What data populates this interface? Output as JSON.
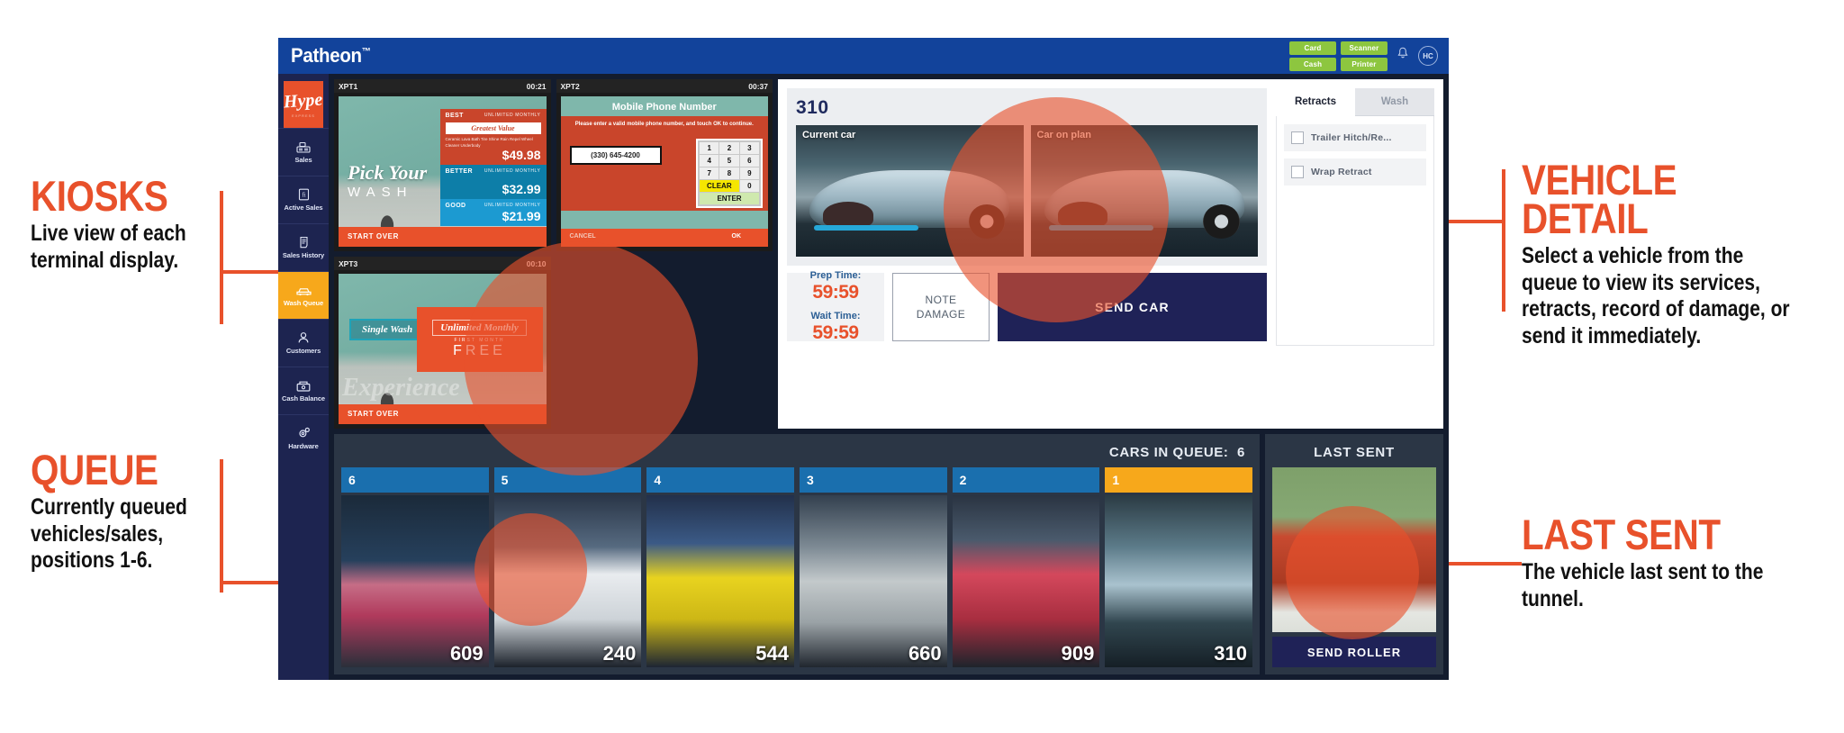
{
  "annotations": [
    {
      "id": "kiosks",
      "title": "KIOSKS",
      "body": "Live view of each terminal display."
    },
    {
      "id": "queue",
      "title": "QUEUE",
      "body": "Currently queued vehicles/sales, positions 1-6."
    },
    {
      "id": "vehicle",
      "title": "VEHICLE DETAIL",
      "body": "Select a vehicle from the queue to view its services, retracts, record of damage, or send it immediately."
    },
    {
      "id": "lastsent",
      "title": "LAST SENT",
      "body": "The vehicle last sent to the tunnel."
    }
  ],
  "app": {
    "brand": "Patheon",
    "brand_mark": "™",
    "header": {
      "badges": [
        "Card",
        "Scanner",
        "Cash",
        "Printer"
      ],
      "bell_icon": "bell-icon",
      "avatar_initials": "HC",
      "badge_color": "#8dc63f",
      "titlebar_color": "#12439b"
    },
    "sidebar": {
      "logo_word": "Hype",
      "logo_sub": "EXPRESS",
      "items": [
        {
          "label": "Sales",
          "icon": "register-icon",
          "active": false
        },
        {
          "label": "Active Sales",
          "icon": "receipt-icon",
          "active": false
        },
        {
          "label": "Sales History",
          "icon": "printout-icon",
          "active": false
        },
        {
          "label": "Wash Queue",
          "icon": "car-icon",
          "active": true
        },
        {
          "label": "Customers",
          "icon": "person-icon",
          "active": false
        },
        {
          "label": "Cash Balance",
          "icon": "cashbox-icon",
          "active": false
        },
        {
          "label": "Hardware",
          "icon": "gear-icon",
          "active": false
        }
      ],
      "active_color": "#F7A81B"
    },
    "kiosks": [
      {
        "name": "XPT1",
        "timer": "00:21",
        "type": "pick-wash",
        "headline_script": "Pick Your",
        "headline_spaced": "WASH",
        "start_over": "START OVER",
        "tiers": [
          {
            "name": "BEST",
            "monthly": "UNLIMITED MONTHLY",
            "pill": "Greatest Value",
            "price": "$49.98",
            "features": "Ceramic\nLava Bath\nTire Shine\nRain Repel\nWheel Cleaner\nUnderbody"
          },
          {
            "name": "BETTER",
            "monthly": "UNLIMITED MONTHLY",
            "pill": "",
            "price": "$32.99",
            "features": ""
          },
          {
            "name": "GOOD",
            "monthly": "UNLIMITED MONTHLY",
            "pill": "",
            "price": "$21.99",
            "features": ""
          }
        ]
      },
      {
        "name": "XPT2",
        "timer": "00:37",
        "type": "phone-entry",
        "title": "Mobile Phone Number",
        "instruction": "Please enter a valid mobile phone number, and touch OK to continue.",
        "value": "(330) 645-4200",
        "keys": [
          "1",
          "2",
          "3",
          "4",
          "5",
          "6",
          "7",
          "8",
          "9"
        ],
        "clear_label": "CLEAR",
        "zero_label": "0",
        "enter_label": "ENTER",
        "cancel_label": "CANCEL",
        "ok_label": "OK"
      },
      {
        "name": "XPT3",
        "timer": "00:10",
        "type": "choose-plan",
        "single_label": "Single Wash",
        "unlimited_label": "Unlimited Monthly",
        "unlimited_sub": "FIRST MONTH",
        "unlimited_free": "FREE",
        "ghost_word": "Experience",
        "start_over": "START OVER"
      }
    ],
    "vehicle_detail": {
      "number": "310",
      "current_car_label": "Current car",
      "car_on_plan_label": "Car on plan",
      "prep_time_label": "Prep Time:",
      "prep_time_value": "59:59",
      "wait_time_label": "Wait Time:",
      "wait_time_value": "59:59",
      "note_damage_line1": "NOTE",
      "note_damage_line2": "DAMAGE",
      "send_car_label": "SEND CAR",
      "tabs": [
        {
          "label": "Retracts",
          "active": true
        },
        {
          "label": "Wash",
          "active": false
        }
      ],
      "retracts": [
        {
          "label": "Trailer Hitch/Re...",
          "checked": false
        },
        {
          "label": "Wrap Retract",
          "checked": false
        }
      ],
      "send_car_color": "#1f2257",
      "accent_color": "#E8512B"
    },
    "queue": {
      "count_label": "CARS IN QUEUE:",
      "count_value": "6",
      "tiles": [
        {
          "position": "6",
          "car_number": "609",
          "selected": false
        },
        {
          "position": "5",
          "car_number": "240",
          "selected": false
        },
        {
          "position": "4",
          "car_number": "544",
          "selected": false
        },
        {
          "position": "3",
          "car_number": "660",
          "selected": false
        },
        {
          "position": "2",
          "car_number": "909",
          "selected": false
        },
        {
          "position": "1",
          "car_number": "310",
          "selected": true
        }
      ]
    },
    "last_sent": {
      "title": "LAST SENT",
      "send_roller_label": "SEND ROLLER"
    }
  }
}
